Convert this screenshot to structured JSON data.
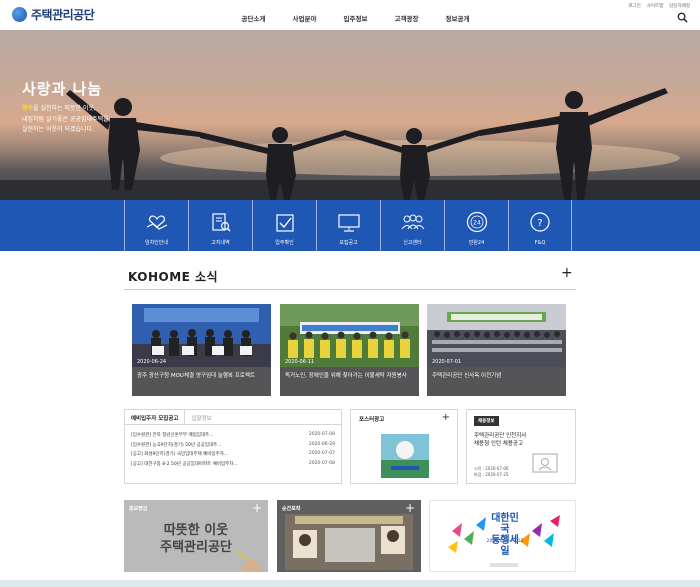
{
  "header": {
    "logo_text": "주택관리공단",
    "nav": [
      "공단소개",
      "사업분야",
      "입주정보",
      "고객광장",
      "정보공개"
    ],
    "util": [
      "로그인",
      "사이트맵",
      "담당자배정"
    ]
  },
  "hero": {
    "title": "사랑과 나눔",
    "desc_highlight": "행복",
    "desc_rest": "을 실천하는 따뜻한 이웃,",
    "desc_line2": "내집처럼 살기좋은 공공임대주택을",
    "desc_line3": "실현하는 이웃이 되겠습니다."
  },
  "quick": [
    {
      "label": "임차인안내",
      "icon": "handshake-heart-icon"
    },
    {
      "label": "고지내역",
      "icon": "document-search-icon"
    },
    {
      "label": "입주확인",
      "icon": "checkbox-icon"
    },
    {
      "label": "모집공고",
      "icon": "monitor-icon"
    },
    {
      "label": "신고센터",
      "icon": "people-group-icon"
    },
    {
      "label": "민원24",
      "icon": "circle-24-icon"
    },
    {
      "label": "F&Q",
      "icon": "question-bubble-icon"
    }
  ],
  "news_section": {
    "title": "KOHOME 소식",
    "items": [
      {
        "date": "2020-06-24",
        "caption": "광주 광산구청 MOU체결 영구임대 늘행복 프로젝트"
      },
      {
        "date": "2020-06-11",
        "caption": "독거노인, 장애인을 위해 찾아가는 이불세탁 자원봉사"
      },
      {
        "date": "2020-07-01",
        "caption": "주택관리공단 신사옥 이전기념"
      }
    ]
  },
  "notice_board": {
    "tab_active": "예비입주자 모집공고",
    "tab_inactive": "입찰정보",
    "rows": [
      {
        "title": "[임수원관] 전북 청년신혼부부 매입임대주...",
        "date": "2020-07-08"
      },
      {
        "title": "[임수원관] 능곡9단지(경기) 50년 공공임대주...",
        "date": "2020-06-29"
      },
      {
        "title": "[공고] 화성9단지(경기) 국민임대주택 예비입주자...",
        "date": "2020-07-07"
      },
      {
        "title": "[공고] 대전구봉 8-2 50년 공공임대아파트 예비입주자...",
        "date": "2020-07-08"
      }
    ]
  },
  "poster_board": {
    "title": "포스터광고"
  },
  "recruit_board": {
    "badge": "채용정보",
    "title_line1": "주택관리공단 인천지사",
    "title_line2": "채용형 인턴 채용공고",
    "start": "시작 : 2020-07-06",
    "end": "마감 : 2020-07-25"
  },
  "banners": {
    "video_label": "홍보영상",
    "video_text_line1": "따뜻한 이웃",
    "video_text_line2": "주택관리공단",
    "photo_label": "순간포착",
    "sale_line1": "대한민국",
    "sale_line2": "동행세일",
    "sale_dates": "2020.6.26~7.12"
  },
  "colors": {
    "brand_blue": "#1f57b5",
    "dark_caption": "#555557",
    "highlight": "#f6d640"
  }
}
